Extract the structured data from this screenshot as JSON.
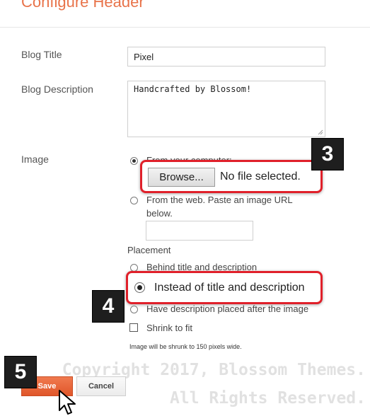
{
  "header": {
    "title": "Configure Header"
  },
  "fields": {
    "blog_title": {
      "label": "Blog Title",
      "value": "Pixel"
    },
    "blog_description": {
      "label": "Blog Description",
      "value": "Handcrafted by Blossom!"
    }
  },
  "image": {
    "label": "Image",
    "source_options": {
      "computer": "From your computer:",
      "web": "From the web. Paste an image URL below."
    },
    "browse_label": "Browse...",
    "file_status": "No file selected.",
    "url_value": ""
  },
  "placement": {
    "label": "Placement",
    "options": {
      "behind": "Behind title and description",
      "instead": "Instead of title and description",
      "after": "Have description placed after the image"
    },
    "selected": "instead"
  },
  "shrink": {
    "label": "Shrink to fit",
    "checked": false
  },
  "note": "Image will be shrunk to 150 pixels wide.",
  "actions": {
    "save": "Save",
    "cancel": "Cancel"
  },
  "steps": {
    "three": "3",
    "four": "4",
    "five": "5"
  },
  "watermark": {
    "line1": "Copyright 2017, Blossom Themes.",
    "line2": "All Rights Reserved."
  },
  "colors": {
    "accent": "#e8734a",
    "highlight": "#e0202a",
    "save_button": "#e8663b",
    "badge": "#1e1e1e"
  }
}
